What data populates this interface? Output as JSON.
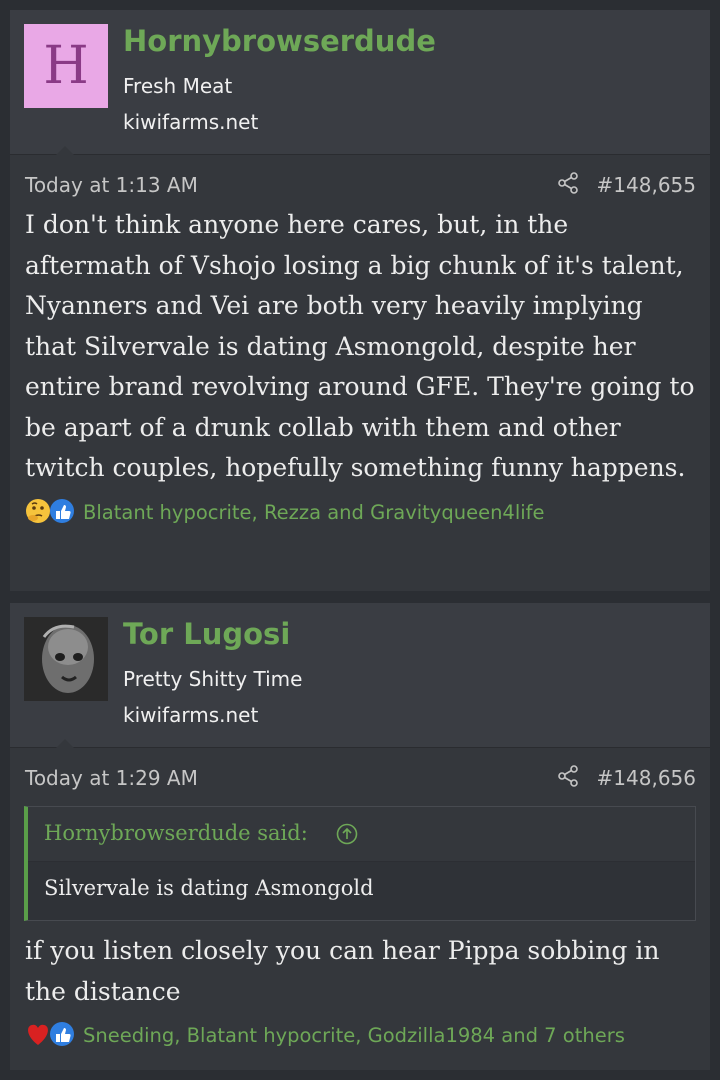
{
  "posts": [
    {
      "avatar_letter": "H",
      "username": "Hornybrowserdude",
      "user_title": "Fresh Meat",
      "site": "kiwifarms.net",
      "timestamp": "Today at 1:13 AM",
      "post_number": "#148,655",
      "message": "I don't think anyone here cares, but, in the aftermath of Vshojo losing a big chunk of it's talent, Nyanners and Vei are both very heavily implying that Silvervale is dating Asmongold, despite her entire brand revolving around GFE. They're going to be apart of a drunk collab with them and other twitch couples, hopefully something funny happens.",
      "reaction_icons": [
        "thinking-emoji-icon",
        "like-thumb-icon"
      ],
      "reactions": "Blatant hypocrite, Rezza and Gravityqueen4life"
    },
    {
      "username": "Tor Lugosi",
      "user_title": "Pretty Shitty Time",
      "site": "kiwifarms.net",
      "timestamp": "Today at 1:29 AM",
      "post_number": "#148,656",
      "quote_author": "Hornybrowserdude said:",
      "quote_text": "Silvervale is dating Asmongold",
      "message": "if you listen closely you can hear Pippa sobbing in the distance",
      "reaction_icons": [
        "heart-icon",
        "like-thumb-icon"
      ],
      "reactions": "Sneeding, Blatant hypocrite, Godzilla1984 and 7 others"
    }
  ],
  "colors": {
    "username": "#6ea857",
    "background": "#2b2e33",
    "post_bg": "#34373c",
    "header_bg": "#3a3d43"
  }
}
